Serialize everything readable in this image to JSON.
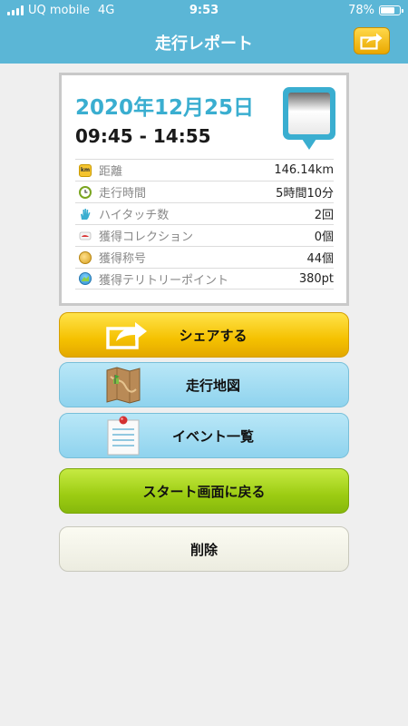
{
  "status_bar": {
    "carrier": "UQ mobile",
    "network": "4G",
    "time": "9:53",
    "battery_text": "78%",
    "battery_level": 0.78
  },
  "nav": {
    "title": "走行レポート",
    "share_icon": "share-arrow-icon",
    "bar_color": "#5bb6d6"
  },
  "report": {
    "date": "2020年12月25日",
    "time_range": "09:45 - 14:55",
    "stats": [
      {
        "icon": "km-icon",
        "label": "距離",
        "value": "146.14km"
      },
      {
        "icon": "clock-icon",
        "label": "走行時間",
        "value": "5時間10分"
      },
      {
        "icon": "hand-icon",
        "label": "ハイタッチ数",
        "value": "2回"
      },
      {
        "icon": "collection-icon",
        "label": "獲得コレクション",
        "value": "0個"
      },
      {
        "icon": "medal-icon",
        "label": "獲得称号",
        "value": "44個"
      },
      {
        "icon": "territory-icon",
        "label": "獲得テリトリーポイント",
        "value": "380pt"
      }
    ]
  },
  "buttons": {
    "share": "シェアする",
    "map": "走行地図",
    "events": "イベント一覧",
    "start": "スタート画面に戻る",
    "delete": "削除"
  },
  "colors": {
    "accent_blue": "#3aaed0",
    "share_yellow": "#f5c100",
    "map_blue": "#8fd3ee",
    "start_green": "#9ccc12"
  }
}
